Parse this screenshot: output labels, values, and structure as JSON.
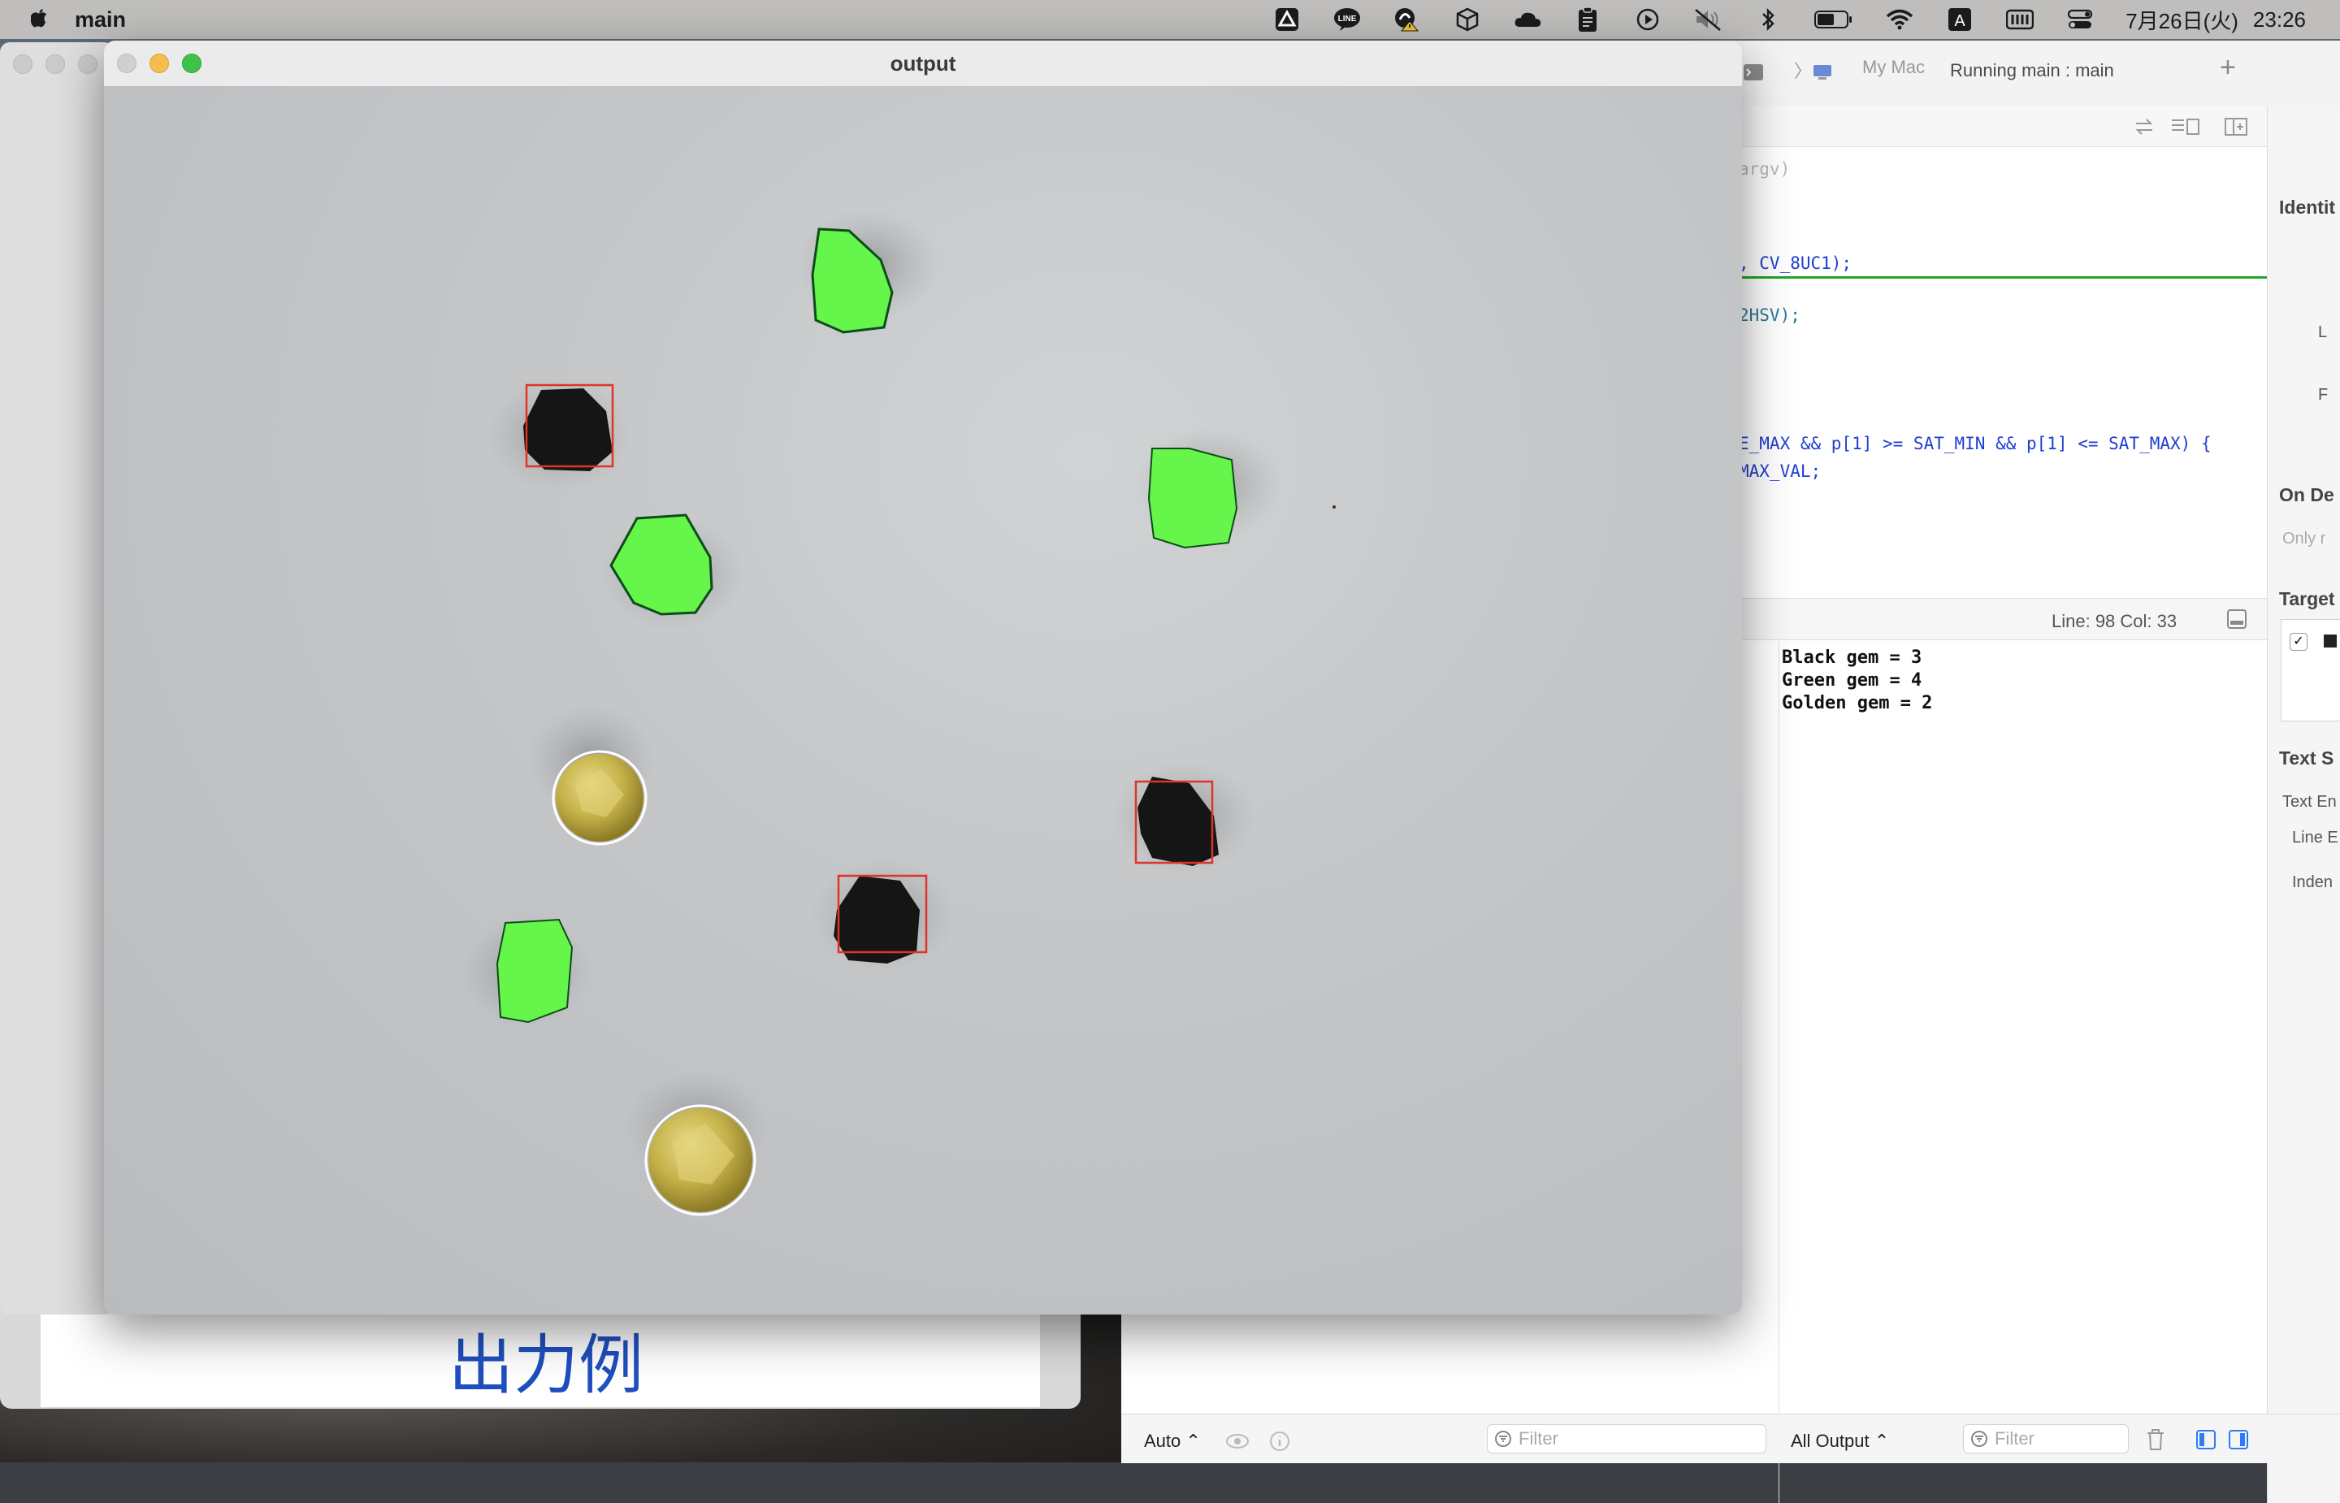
{
  "menubar": {
    "app_name": "main",
    "date": "7月26日(火)",
    "time": "23:26",
    "icons": [
      "apple-icon",
      "drive-icon",
      "line-icon",
      "tracker-icon",
      "box-icon",
      "cloud-icon",
      "clipboard-icon",
      "play-icon",
      "mute-icon",
      "bluetooth-icon",
      "battery-icon",
      "wifi-icon",
      "input-method-icon",
      "keyboard-icon",
      "control-center-icon"
    ],
    "input_method_label": "A",
    "line_label": "LINE"
  },
  "output_window": {
    "title": "output"
  },
  "detection": {
    "black_gems": 3,
    "green_gems": 4,
    "golden_gems": 2,
    "colors": {
      "green_fill": "#66f54a",
      "black_box": "#e0332c",
      "golden_circle": "#ffffff",
      "gem_black": "#151515",
      "gem_gold": "#c9b64a"
    }
  },
  "xcode": {
    "breadcrumb_device": "My Mac",
    "run_status": "Running main : main",
    "args_hint": "argv)",
    "code_lines": [
      {
        "text": ", CV_8UC1);"
      },
      {
        "text": "2HSV);"
      },
      {
        "text": "E_MAX && p[1] >= SAT_MIN && p[1] <= SAT_MAX) {"
      },
      {
        "text": "MAX_VAL;"
      }
    ],
    "line_col": "Line: 98  Col: 33",
    "console_lines": [
      "Black gem = 3",
      "Green gem = 4",
      "Golden gem = 2"
    ],
    "bottom": {
      "auto_label": "Auto ⌃",
      "filter_placeholder_left": "Filter",
      "all_output": "All Output ⌃",
      "filter_placeholder_right": "Filter"
    },
    "inspector": {
      "identity": "Identit",
      "l_label": "L",
      "f_label": "F",
      "on_demand": "On De",
      "only_hint": "Only r",
      "target": "Target",
      "text_settings": "Text S",
      "text_encoding": "Text En",
      "line_endings": "Line E",
      "indent": "Inden"
    }
  },
  "slide": {
    "caption": "出力例"
  }
}
